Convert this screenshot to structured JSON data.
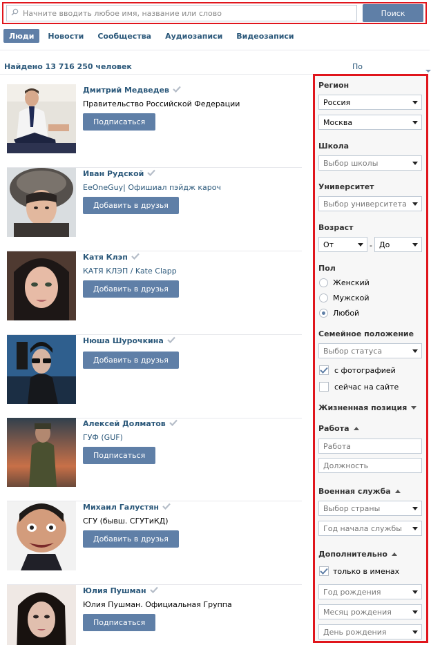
{
  "search": {
    "placeholder": "Начните вводить любое имя, название или слово",
    "button_label": "Поиск"
  },
  "tabs": [
    {
      "label": "Люди",
      "active": true
    },
    {
      "label": "Новости",
      "active": false
    },
    {
      "label": "Сообщества",
      "active": false
    },
    {
      "label": "Аудиозаписи",
      "active": false
    },
    {
      "label": "Видеозаписи",
      "active": false
    }
  ],
  "results": {
    "found_text": "Найдено 13 716 250 человек",
    "sort_label": "По популярности"
  },
  "people": [
    {
      "name": "Дмитрий Медведев",
      "desc": "Правительство Российской Федерации",
      "button": "Подписаться"
    },
    {
      "name": "Иван Рудской",
      "desc": "EeOneGuy| Офишиал пэйдж кароч",
      "button": "Добавить в друзья"
    },
    {
      "name": "Катя Клэп",
      "desc": "КАТЯ КЛЭП / Kate Clapp",
      "button": "Добавить в друзья"
    },
    {
      "name": "Нюша Шурочкина",
      "desc": "",
      "button": "Добавить в друзья"
    },
    {
      "name": "Алексей Долматов",
      "desc": "ГУФ (GUF)",
      "button": "Подписаться"
    },
    {
      "name": "Михаил Галустян",
      "desc": "СГУ (бывш. СГУТиКД)",
      "button": "Добавить в друзья"
    },
    {
      "name": "Юлия Пушман",
      "desc": "Юлия Пушман. Официальная Группа",
      "button": "Подписаться"
    }
  ],
  "filters": {
    "region": {
      "title": "Регион",
      "country": "Россия",
      "city": "Москва"
    },
    "school": {
      "title": "Школа",
      "placeholder": "Выбор школы"
    },
    "university": {
      "title": "Университет",
      "placeholder": "Выбор университета"
    },
    "age": {
      "title": "Возраст",
      "from": "От",
      "to": "До",
      "dash": "-"
    },
    "gender": {
      "title": "Пол",
      "options": [
        "Женский",
        "Мужской",
        "Любой"
      ],
      "selected": "Любой"
    },
    "marital": {
      "title": "Семейное положение",
      "placeholder": "Выбор статуса"
    },
    "with_photo": {
      "label": "с фотографией",
      "checked": true
    },
    "online": {
      "label": "сейчас на сайте",
      "checked": false
    },
    "life_position": {
      "title": "Жизненная позиция"
    },
    "work": {
      "title": "Работа",
      "company_placeholder": "Работа",
      "position_placeholder": "Должность"
    },
    "military": {
      "title": "Военная служба",
      "country_placeholder": "Выбор страны",
      "year_placeholder": "Год начала службы"
    },
    "extra": {
      "title": "Дополнительно",
      "names_only_label": "только в именах",
      "names_only_checked": true,
      "birth_year": "Год рождения",
      "birth_month": "Месяц рождения",
      "birth_day": "День рождения"
    }
  },
  "colors": {
    "accent": "#5f7fa7",
    "link": "#2b587a",
    "highlight": "#e0151c"
  }
}
